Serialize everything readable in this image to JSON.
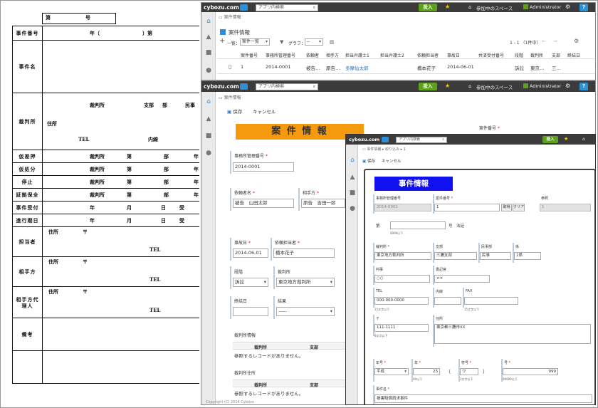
{
  "paper": {
    "top_label_1": "第",
    "top_label_2": "号",
    "rows": {
      "jiken_bango": "事件番号",
      "jiken_bango_val1": "年（",
      "jiken_bango_val2": "）第",
      "jikenmei": "事件名",
      "saibansho": "裁判所",
      "saibansho_a": "裁判所",
      "saibansho_b": "支部",
      "saibansho_c": "部",
      "saibansho_d": "民事",
      "jusho": "住所",
      "tel": "TEL",
      "naisen": "内線",
      "kariosae": "仮差押",
      "karishobun": "仮処分",
      "teishi": "停止",
      "shokenhozen": "証拠保全",
      "sub_saibansho": "裁判所",
      "sub_dai": "第",
      "sub_bu": "部",
      "sub_nen": "年",
      "jiken_uketsuke": "事件受付",
      "shinkou": "進行期日",
      "u_nen": "年",
      "u_tsuki": "月",
      "u_hi": "日",
      "u_uke": "受",
      "tantousha": "担当者",
      "aitekata": "相手方",
      "aitekata_dairi": "相手方代理人",
      "bikou": "備考",
      "jusho_maru": "住所",
      "yubin": "〒"
    }
  },
  "win1": {
    "logo": "cybozu.com",
    "search_placeholder": "アプリ内検索",
    "post": "投入",
    "spaces": "参加中のスペース",
    "admin": "Administrator",
    "help": "?",
    "crumb": "案件情報",
    "title": "案件情報",
    "view_label": "一覧：",
    "view_value": "案件一覧",
    "graph_label": "グラフ：",
    "graph_value": "--",
    "pager": "1 - 1 （1件中）",
    "columns": [
      "案件番号",
      "事務所管理番号",
      "依頼者",
      "相手方",
      "担当弁護士1",
      "担当弁護士2",
      "依頼担当者",
      "事故日",
      "共済受付番号",
      "段階",
      "裁判所",
      "支部",
      "終結日"
    ],
    "row": {
      "no": "1",
      "kanri": "2014-0001",
      "irai": "被告…",
      "aite": "原告…",
      "bengoshi1": "多摩仙太郎",
      "tanto": "橋本花子",
      "jikobi": "2014-06-01",
      "dankai": "訴訟",
      "saibansho": "東京…",
      "shibu": "三…"
    }
  },
  "win2": {
    "logo": "cybozu.com",
    "search_placeholder": "アプリ内検索",
    "post": "投入",
    "spaces": "参加中のスペース",
    "admin": "Administrator",
    "help": "?",
    "crumb": "案件情報",
    "save": "保存",
    "cancel": "キャンセル",
    "banner": "案 件 情 報",
    "case_no_label": "案件番号",
    "kanri_label": "事務所管理番号",
    "kanri_value": "2014-0001",
    "iraisha_label": "依頼者名",
    "iraisha_value": "被告　山田太郎",
    "aite_label": "相手方",
    "aite_value": "原告　吉田一郎",
    "jikobi_label": "事故日",
    "jikobi_value": "2014-06-01",
    "tanto_label": "依頼担当者",
    "tanto_value": "橋本花子",
    "dankai_label": "段階",
    "dankai_value": "訴訟",
    "saibansho_label": "裁判所",
    "saibansho_value": "東京地方裁判所",
    "shuketsu_label": "終結日",
    "kekka_label": "結果",
    "kekka_value": "-----",
    "court_info": "裁判所情報",
    "court_col1": "裁判所",
    "court_col2": "支部",
    "no_record": "参照するレコードがありません。",
    "court_addr": "裁判所住所",
    "footer": "Copyright (C) 2014 Cybozu"
  },
  "win3": {
    "logo": "cybozu.com",
    "search_placeholder": "アプリ内検索",
    "post": "投入",
    "crumb1": "事件情報",
    "crumb2": "絞り込み",
    "crumb3": "1",
    "save": "保存",
    "cancel": "キャンセル",
    "banner": "事件情報",
    "kanri_label": "事務所管理番号",
    "kanri_value": "2014-0001",
    "case_no_label": "案件番号",
    "case_no_value": "1",
    "get_btn": "取得",
    "clear_btn": "クリア",
    "sansho_label": "参照",
    "sansho_value": "1",
    "dai": "第",
    "go_katsu": "号　法廷",
    "hint_9999": "9999以下",
    "saibansho_label": "裁判所",
    "saibansho_value": "東京地方裁判所",
    "shibu_label": "支部",
    "shibu_value": "三鷹支部",
    "minjibu_label": "民事部",
    "minjibu_value": "民事",
    "kakari_label": "係",
    "kakari_value": "1係",
    "hanji_label": "判事",
    "hanji_value": "○○",
    "shokikan_label": "書記官",
    "shokikan_value": "××",
    "tel_label": "TEL",
    "tel_value": "000-000-0000",
    "naisen_label": "内線",
    "fax_label": "FAX",
    "hint_15": "15文字以下",
    "yubin_label": "〒",
    "yubin_value": "111-1111",
    "hint_8": "8文字以下",
    "jusho_label": "住所",
    "jusho_value": "東京都三鷹市XX",
    "nengo_label": "年号",
    "nengo_value": "平成",
    "nen_label": "年",
    "nen_value": "23",
    "paren_open": "（",
    "paren_close": "）",
    "fugo_label": "符号",
    "fugo_value": "ワ",
    "go_label": "号",
    "go_value": "999",
    "hint_99": "99以下",
    "hint_3": "3文字以下",
    "hint_99999": "99999以下",
    "jikenmei_label": "事件名",
    "jikenmei_value": "損害賠償請求事件"
  },
  "colors": {
    "header": "#3b3b3b",
    "accent": "#2d8fd5",
    "post": "#5da01c",
    "banner_orange": "#f59a0c",
    "banner_blue": "#1010f0"
  }
}
